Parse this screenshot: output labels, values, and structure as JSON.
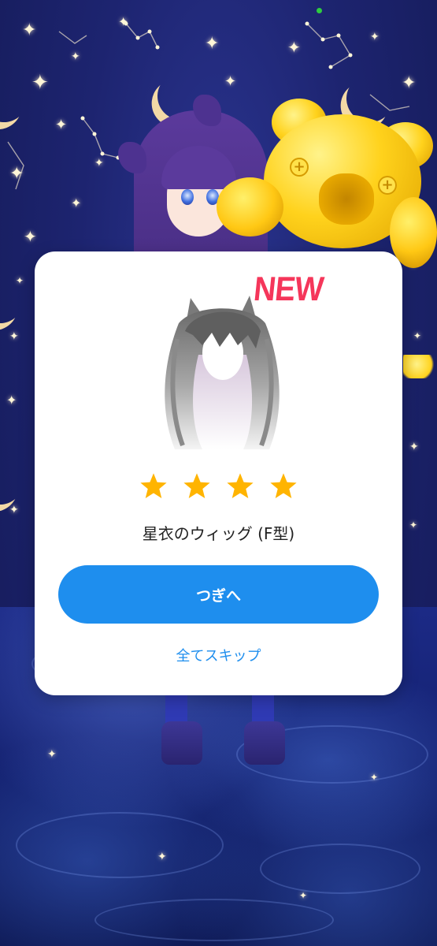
{
  "reward_dialog": {
    "badge": "NEW",
    "rarity_stars": 4,
    "item_name": "星衣のウィッグ (F型)",
    "next_button_label": "つぎへ",
    "skip_all_label": "全てスキップ"
  },
  "colors": {
    "accent": "#1e8eee",
    "badge": "#f5365a",
    "star": "#ffb400",
    "card": "#ffffff"
  }
}
